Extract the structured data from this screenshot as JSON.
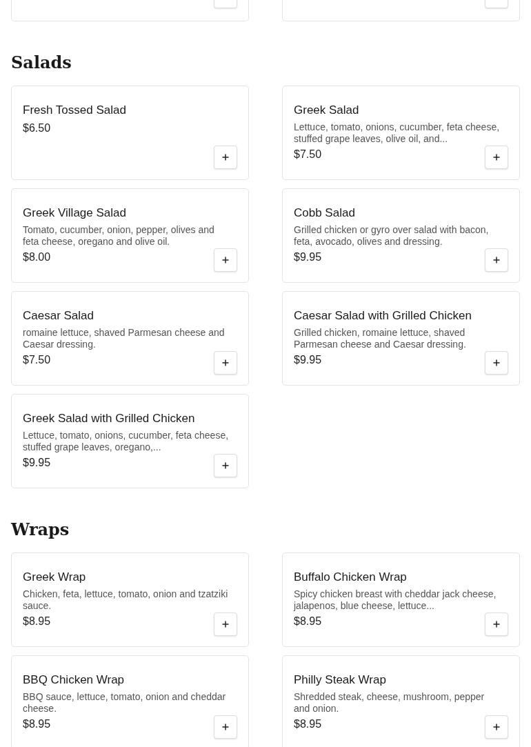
{
  "previous_section": {
    "cut_off_cards": [
      {
        "kind": "add-only"
      },
      {
        "kind": "add-only"
      }
    ]
  },
  "sections": [
    {
      "title": "Salads",
      "items": [
        {
          "name": "Fresh Tossed Salad",
          "price": "$6.50"
        },
        {
          "name": "Greek Salad",
          "description": "Lettuce, tomato, onions, cucumber, feta cheese, stuffed grape leaves, olive oil, and...",
          "price": "$7.50"
        },
        {
          "name": "Greek Village Salad",
          "description": "Tomato, cucumber, onion, pepper, olives and feta cheese, oregano and olive oil.",
          "price": "$8.00"
        },
        {
          "name": "Cobb Salad",
          "description": "Grilled chicken or gyro over salad with bacon, feta, avocado, olives and dressing.",
          "price": "$9.95"
        },
        {
          "name": "Caesar Salad",
          "description": "romaine lettuce, shaved Parmesan cheese and Caesar dressing.",
          "price": "$7.50"
        },
        {
          "name": "Caesar Salad with Grilled Chicken",
          "description": "Grilled chicken, romaine lettuce, shaved Parmesan cheese and Caesar dressing.",
          "price": "$9.95"
        },
        {
          "name": "Greek Salad with Grilled Chicken",
          "description": "Lettuce, tomato, onions, cucumber, feta cheese, stuffed grape leaves, oregano,...",
          "price": "$9.95"
        }
      ]
    },
    {
      "title": "Wraps",
      "items": [
        {
          "name": "Greek Wrap",
          "description": "Chicken, feta, lettuce, tomato, onion and tzatziki sauce.",
          "price": "$8.95"
        },
        {
          "name": "Buffalo Chicken Wrap",
          "description": "Spicy chicken breast with cheddar jack cheese, jalapenos, blue cheese, lettuce...",
          "price": "$8.95"
        },
        {
          "name": "BBQ Chicken Wrap",
          "description": "BBQ sauce, lettuce, tomato, onion and cheddar cheese.",
          "price": "$8.95"
        },
        {
          "name": "Philly Steak Wrap",
          "description": "Shredded steak, cheese, mushroom, pepper and onion.",
          "price": "$8.95"
        }
      ]
    }
  ]
}
